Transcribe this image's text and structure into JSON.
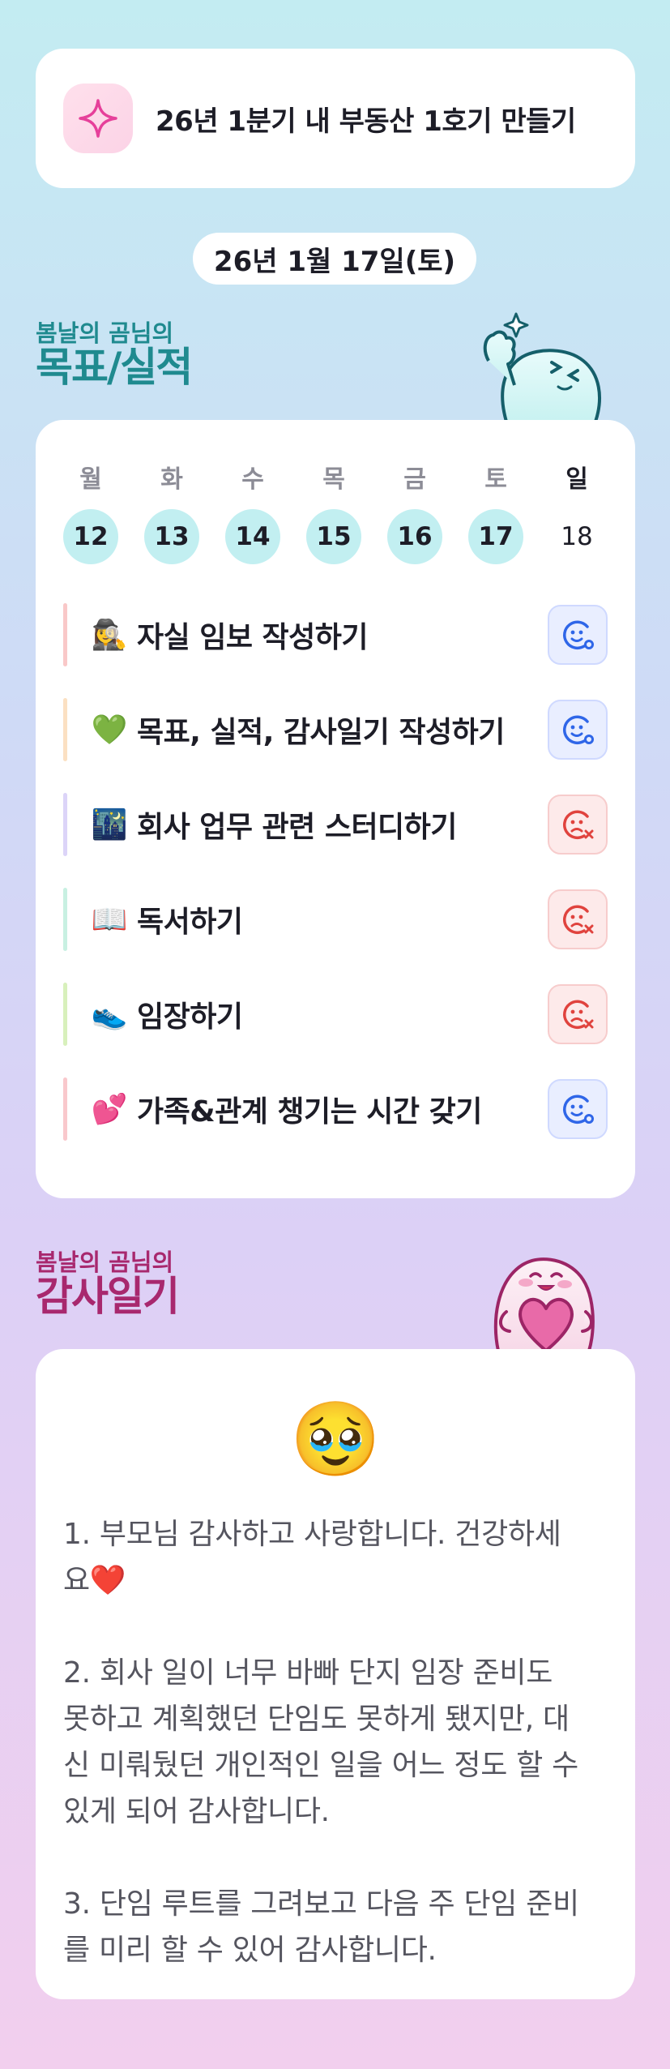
{
  "goal": {
    "title": "26년 1분기 내 부동산 1호기 만들기",
    "icon": "sparkle-icon"
  },
  "date": "26년 1월 17일(토)",
  "goals_section": {
    "small": "봄날의 곰님의",
    "big": "목표/실적",
    "color": "#1f8a8f"
  },
  "week": {
    "days": [
      "월",
      "화",
      "수",
      "목",
      "금",
      "토",
      "일"
    ],
    "dates": [
      "12",
      "13",
      "14",
      "15",
      "16",
      "17",
      "18"
    ]
  },
  "tasks": [
    {
      "emoji": "🕵️‍♀️",
      "label": "자실 임보 작성하기",
      "bar_color": "#f9c8c8",
      "status": "done"
    },
    {
      "emoji": "💚",
      "label": "목표, 실적, 감사일기 작성하기",
      "bar_color": "#fbe0c2",
      "status": "done"
    },
    {
      "emoji": "🌃",
      "label": "회사 업무 관련 스터디하기",
      "bar_color": "#dcd4f8",
      "status": "missed"
    },
    {
      "emoji": "📖",
      "label": "독서하기",
      "bar_color": "#c8f0e2",
      "status": "missed"
    },
    {
      "emoji": "👟",
      "label": "임장하기",
      "bar_color": "#d8f0bc",
      "status": "missed"
    },
    {
      "emoji": "💕",
      "label": "가족&관계 챙기는 시간 갖기",
      "bar_color": "#f9c8cc",
      "status": "done"
    }
  ],
  "gratitude_section": {
    "small": "봄날의 곰님의",
    "big": "감사일기",
    "color": "#a8286e"
  },
  "gratitude": {
    "emoji": "🥹",
    "text": "1. 부모님 감사하고 사랑합니다. 건강하세\n요❤️\n\n2. 회사 일이 너무 바빠 단지 임장 준비도\n못하고 계획했던 단임도 못하게 됐지만, 대\n신 미뤄뒀던 개인적인 일을 어느 정도 할 수\n있게 되어 감사합니다.\n\n3. 단임 루트를 그려보고 다음 주 단임 준비\n를 미리 할 수 있어 감사합니다."
  },
  "colors": {
    "done": "#2f66e8",
    "missed": "#e0433e",
    "today_circle": "#c2eff1"
  }
}
